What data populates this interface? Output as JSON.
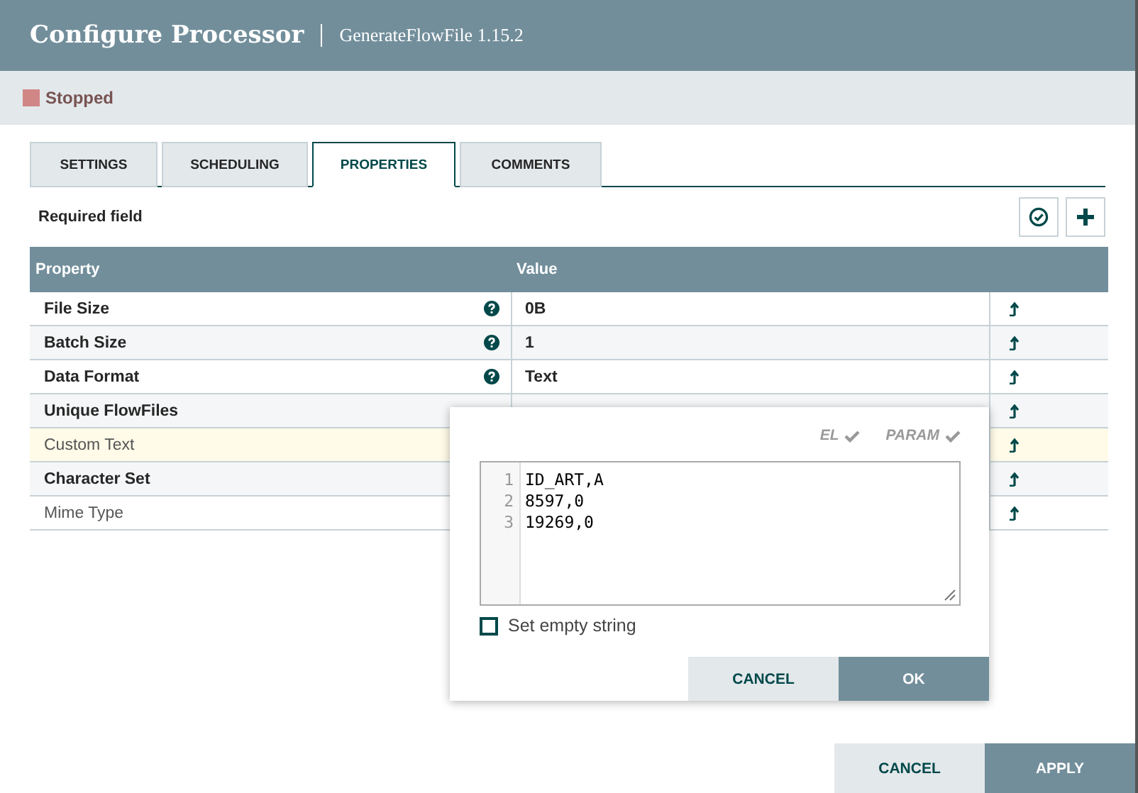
{
  "window": {
    "title": "Configure Processor",
    "subtitle": "GenerateFlowFile 1.15.2"
  },
  "status": {
    "label": "Stopped",
    "color": "#d18686"
  },
  "tabs": [
    {
      "label": "SETTINGS",
      "selected": false
    },
    {
      "label": "SCHEDULING",
      "selected": false
    },
    {
      "label": "PROPERTIES",
      "selected": true
    },
    {
      "label": "COMMENTS",
      "selected": false
    }
  ],
  "required_note": "Required field",
  "table": {
    "columns": [
      "Property",
      "Value"
    ],
    "rows": [
      {
        "name": "File Size",
        "required": true,
        "help": true,
        "value": "0B",
        "selected": false
      },
      {
        "name": "Batch Size",
        "required": true,
        "help": true,
        "value": "1",
        "selected": false
      },
      {
        "name": "Data Format",
        "required": true,
        "help": true,
        "value": "Text",
        "selected": false
      },
      {
        "name": "Unique FlowFiles",
        "required": true,
        "help": false,
        "selected": false
      },
      {
        "name": "Custom Text",
        "required": false,
        "help": false,
        "selected": true
      },
      {
        "name": "Character Set",
        "required": true,
        "help": false,
        "selected": false
      },
      {
        "name": "Mime Type",
        "required": false,
        "help": false,
        "selected": false
      }
    ]
  },
  "editor": {
    "flags": [
      "EL",
      "PARAM"
    ],
    "lines": [
      {
        "number": "1",
        "text": "ID_ART,A"
      },
      {
        "number": "2",
        "text": "8597,0"
      },
      {
        "number": "3",
        "text": "19269,0"
      }
    ],
    "empty_string": {
      "label": "Set empty string",
      "checked": false
    },
    "buttons": [
      "CANCEL",
      "OK"
    ]
  },
  "buttons": [
    "CANCEL",
    "APPLY"
  ]
}
